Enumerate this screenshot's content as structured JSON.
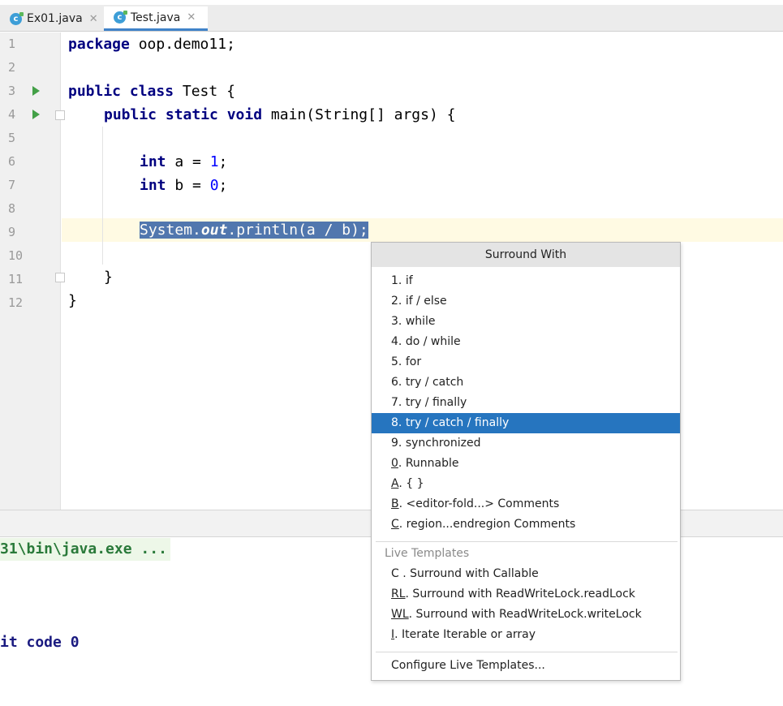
{
  "tabs": [
    {
      "label": "Ex01.java",
      "icon": "java-class-icon",
      "active": false
    },
    {
      "label": "Test.java",
      "icon": "java-class-icon",
      "active": true
    }
  ],
  "gutter": {
    "line_numbers": [
      "1",
      "2",
      "3",
      "4",
      "5",
      "6",
      "7",
      "8",
      "9",
      "10",
      "11",
      "12"
    ]
  },
  "code": {
    "line1": {
      "kw": "package",
      "rest": " oop.demo11;"
    },
    "line3": {
      "kw": "public class",
      "rest": " Test {"
    },
    "line4": {
      "kw": "public static void",
      "rest": " main(String[] args) {"
    },
    "line6": {
      "kw": "int",
      "mid": " a = ",
      "num": "1",
      "end": ";"
    },
    "line7": {
      "kw": "int",
      "mid": " b = ",
      "num": "0",
      "end": ";"
    },
    "line9": {
      "a": "System.",
      "b": "out",
      "c": ".println(a / b);"
    },
    "line11": "}",
    "line12": "}"
  },
  "console": {
    "line1": "31\\bin\\java.exe ...",
    "line2": "it code 0"
  },
  "popup": {
    "title": "Surround With",
    "items": [
      {
        "key": "1",
        "label": ". if"
      },
      {
        "key": "2",
        "label": ". if / else"
      },
      {
        "key": "3",
        "label": ". while"
      },
      {
        "key": "4",
        "label": ". do / while"
      },
      {
        "key": "5",
        "label": ". for"
      },
      {
        "key": "6",
        "label": ". try / catch"
      },
      {
        "key": "7",
        "label": ". try / finally"
      },
      {
        "key": "8",
        "label": ". try / catch / finally"
      },
      {
        "key": "9",
        "label": ". synchronized"
      },
      {
        "key": "0",
        "label": ". Runnable"
      },
      {
        "key": "A",
        "label": ". { }"
      },
      {
        "key": "B",
        "label": ". <editor-fold...> Comments"
      },
      {
        "key": "C",
        "label": ". region...endregion Comments"
      }
    ],
    "selected_index": 7,
    "live_templates_label": "Live Templates",
    "live_items": [
      {
        "key": "C",
        "label": " . Surround with Callable"
      },
      {
        "key": "RL",
        "label": ". Surround with ReadWriteLock.readLock"
      },
      {
        "key": "WL",
        "label": ". Surround with ReadWriteLock.writeLock"
      },
      {
        "key": "I",
        "label": ". Iterate Iterable or array"
      }
    ],
    "configure_label": "Configure Live Templates..."
  },
  "colors": {
    "selection": "#2675bf",
    "keyword": "#000080",
    "number": "#0000ff",
    "static_field": "#660e7a",
    "console_path": "#2a7a3a",
    "console_text": "#1a1a80"
  }
}
